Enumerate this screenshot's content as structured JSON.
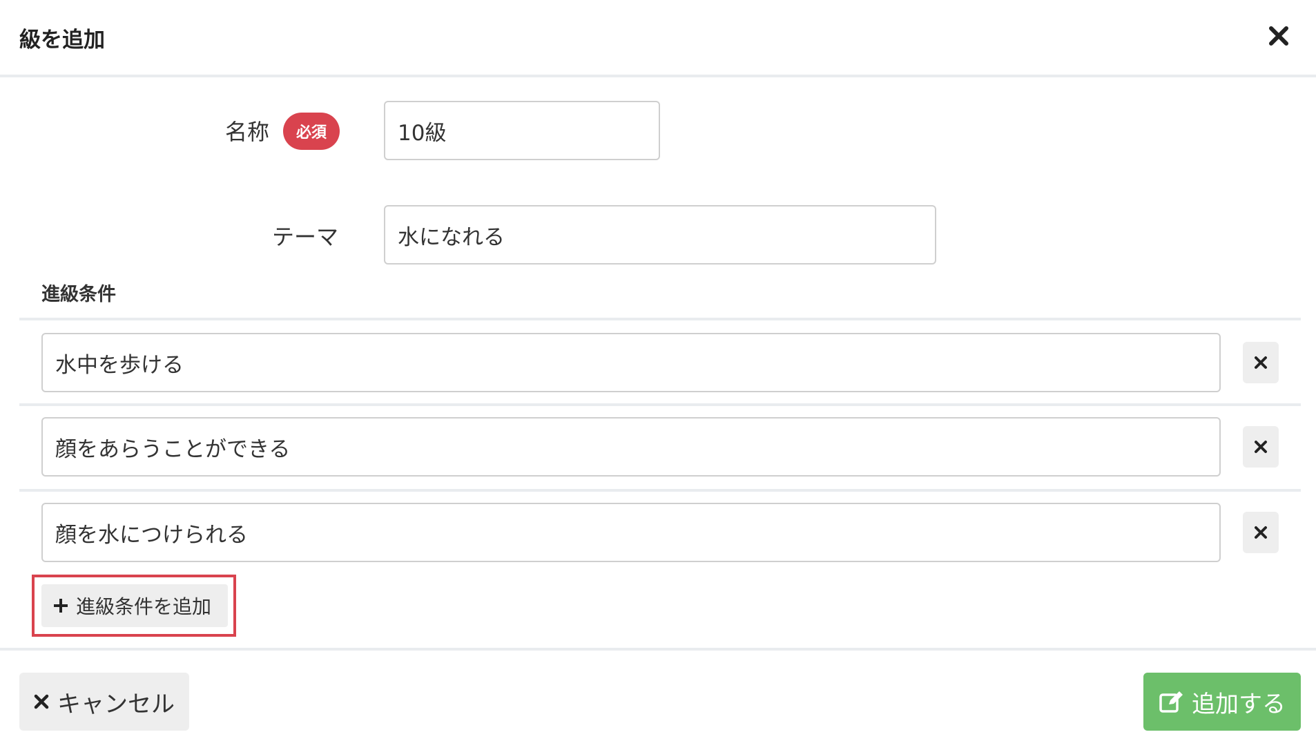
{
  "header": {
    "title": "級を追加",
    "close_icon": "close-icon"
  },
  "form": {
    "name_label": "名称",
    "required_badge": "必須",
    "name_value": "10級",
    "theme_label": "テーマ",
    "theme_value": "水になれる"
  },
  "conditions": {
    "section_title": "進級条件",
    "items": [
      {
        "value": "水中を歩ける"
      },
      {
        "value": "顔をあらうことができる"
      },
      {
        "value": "顔を水につけられる"
      }
    ],
    "add_label": "進級条件を追加"
  },
  "footer": {
    "cancel_label": "キャンセル",
    "submit_label": "追加する"
  },
  "colors": {
    "required": "#d9434e",
    "submit": "#6cbf6a",
    "secondary_button": "#eeeeee",
    "highlight": "#d9434e"
  }
}
